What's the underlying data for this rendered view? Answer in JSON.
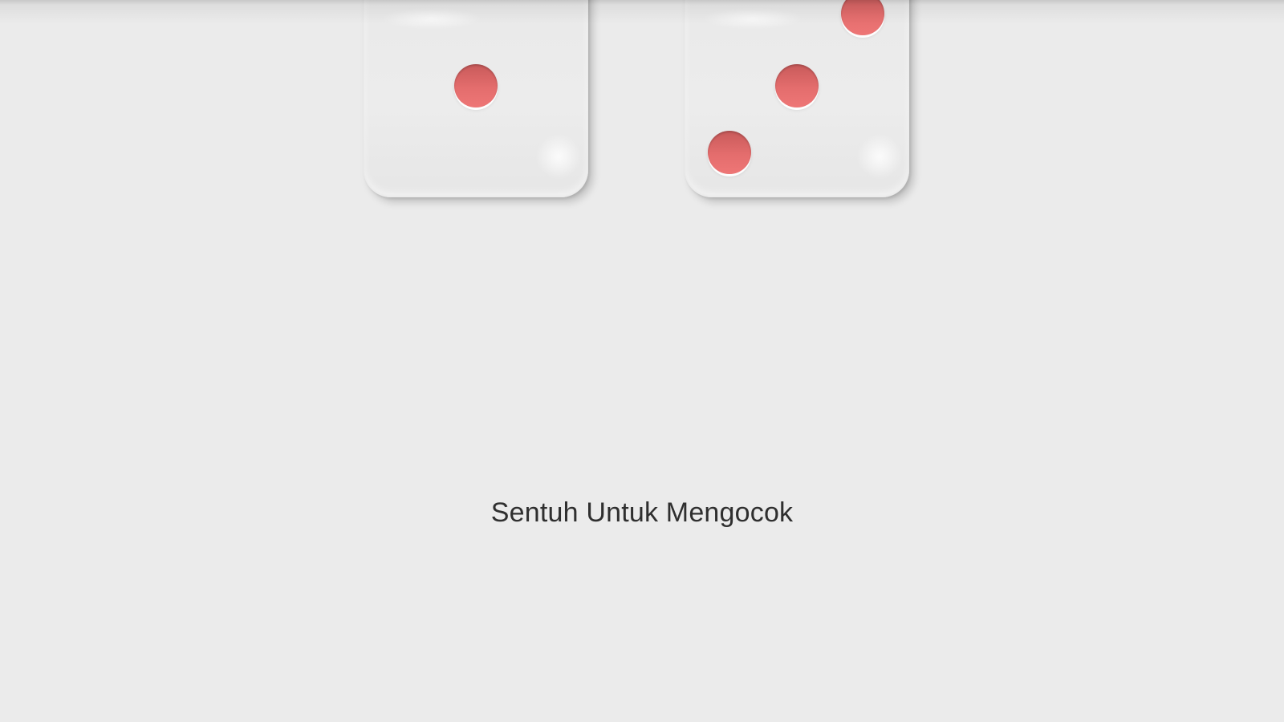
{
  "app": {
    "screen": {
      "background_color": "#ebebeb"
    },
    "dice": [
      {
        "value": 1,
        "face_color": "#ebebeb",
        "pip_color": "#e46d6d",
        "pips": [
          "center"
        ]
      },
      {
        "value": 3,
        "face_color": "#ebebeb",
        "pip_color": "#e46d6d",
        "pips": [
          "top-right",
          "center",
          "bottom-left"
        ]
      }
    ],
    "prompt": {
      "text": "Sentuh Untuk Mengocok",
      "text_color": "#2f2f2f"
    }
  }
}
